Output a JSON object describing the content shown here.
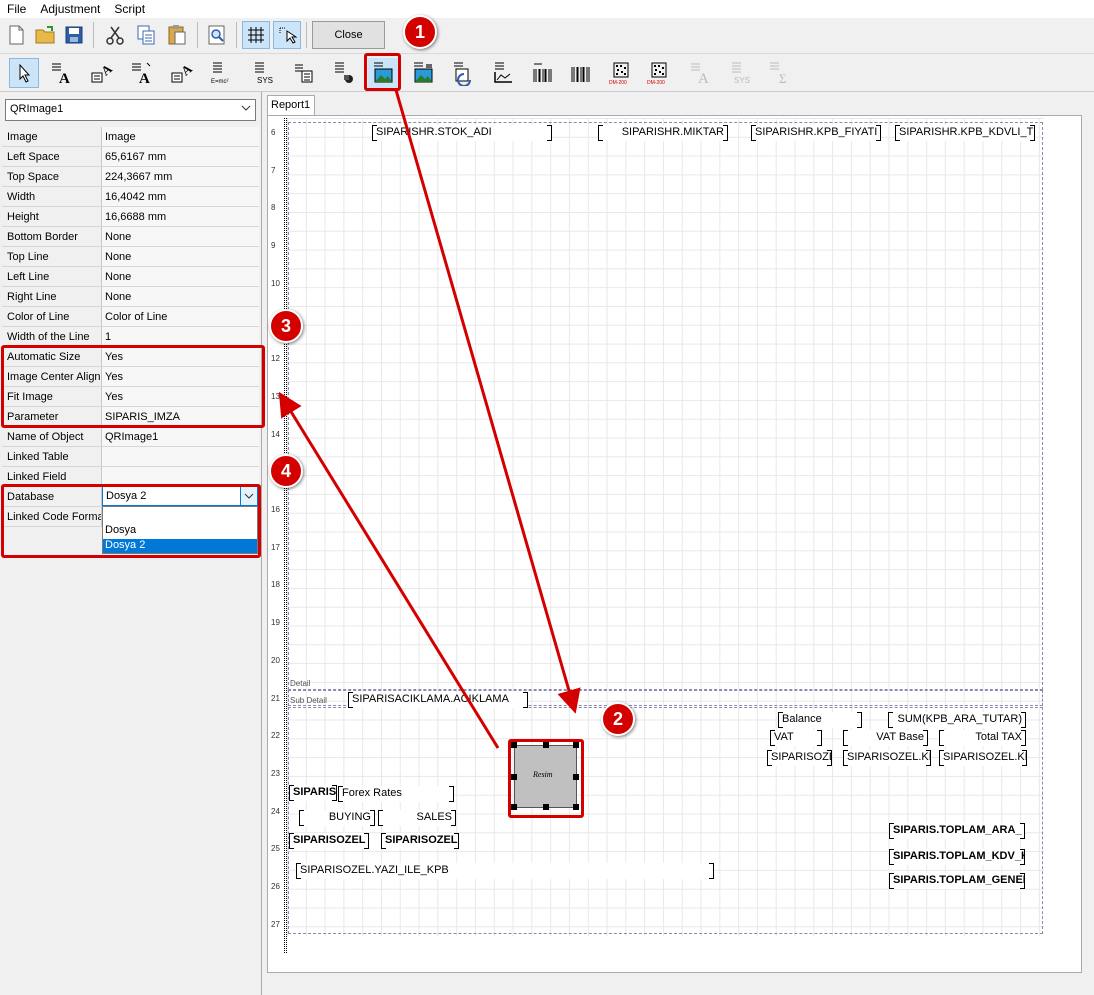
{
  "menu": [
    "File",
    "Adjustment",
    "Script"
  ],
  "toolbar": {
    "close_label": "Close",
    "icons": [
      "new-icon",
      "open-icon",
      "save-icon",
      "cut-icon",
      "copy-icon",
      "paste-icon",
      "preview-icon",
      "grid-icon",
      "snap-icon"
    ]
  },
  "toolbar2": {
    "sys_label": "SYS",
    "dm_label": "DM-200"
  },
  "object_selector": "QRImage1",
  "properties": [
    {
      "key": "Image",
      "value": "Image"
    },
    {
      "key": "Left Space",
      "value": "65,6167 mm"
    },
    {
      "key": "Top Space",
      "value": "224,3667 mm"
    },
    {
      "key": "Width",
      "value": "16,4042 mm"
    },
    {
      "key": "Height",
      "value": "16,6688 mm"
    },
    {
      "key": "Bottom Border",
      "value": "None"
    },
    {
      "key": "Top Line",
      "value": "None"
    },
    {
      "key": "Left Line",
      "value": "None"
    },
    {
      "key": "Right Line",
      "value": "None"
    },
    {
      "key": "Color of Line",
      "value": "Color of Line"
    },
    {
      "key": "Width of the Line",
      "value": "1"
    },
    {
      "key": "Automatic Size",
      "value": "Yes"
    },
    {
      "key": "Image Center Align",
      "value": "Yes"
    },
    {
      "key": "Fit Image",
      "value": "Yes"
    },
    {
      "key": "Parameter",
      "value": "SIPARIS_IMZA"
    },
    {
      "key": "Name of Object",
      "value": "QRImage1"
    },
    {
      "key": "Linked Table",
      "value": ""
    },
    {
      "key": "Linked Field",
      "value": ""
    },
    {
      "key": "Database",
      "value": ""
    },
    {
      "key": "Linked Code Format",
      "value": ""
    }
  ],
  "database": {
    "value": "Dosya 2",
    "options": [
      "",
      "Dosya",
      "Dosya 2"
    ]
  },
  "report": {
    "tab": "Report1",
    "ruler": [
      "6",
      "7",
      "8",
      "9",
      "10",
      "11",
      "12",
      "13",
      "14",
      "15",
      "16",
      "17",
      "18",
      "19",
      "20",
      "21",
      "22",
      "23",
      "24",
      "25",
      "26",
      "27"
    ],
    "bands": {
      "detail": "Detail",
      "subdetail": "Sub Detail"
    },
    "fields": {
      "stok_adi": "SIPARISHR.STOK_ADI",
      "miktar": "SIPARISHR.MIKTAR",
      "fiyat": "SIPARISHR.KPB_FIYATI",
      "kdvli": "SIPARISHR.KPB_KDVLI_TU",
      "aciklama": "SIPARISACIKLAMA.ACIKLAMA",
      "balance": "Balance",
      "sum": "SUM(KPB_ARA_TUTAR)",
      "vat": "VAT",
      "vatbase": "VAT Base",
      "totaltax": "Total TAX",
      "sipoz1": "SIPARISOZE",
      "sipoz2": "SIPARISOZEL.KD",
      "sipoz3": "SIPARISOZEL.KD",
      "siparis": "SIPARIS.",
      "forex": "Forex Rates",
      "buying": "BUYING",
      "sales": "SALES",
      "sipoz4": "SIPARISOZEL",
      "sipoz5": "SIPARISOZEL",
      "yazi": "SIPARISOZEL.YAZI_ILE_KPB",
      "ara": "SIPARIS.TOPLAM_ARA_",
      "kdv": "SIPARIS.TOPLAM_KDV_K",
      "genel": "SIPARIS.TOPLAM_GENEL"
    },
    "image_caption": "Resim"
  },
  "annotations": [
    "1",
    "2",
    "3",
    "4"
  ],
  "colors": {
    "annotation": "#d40000",
    "selection": "#0078d7"
  }
}
